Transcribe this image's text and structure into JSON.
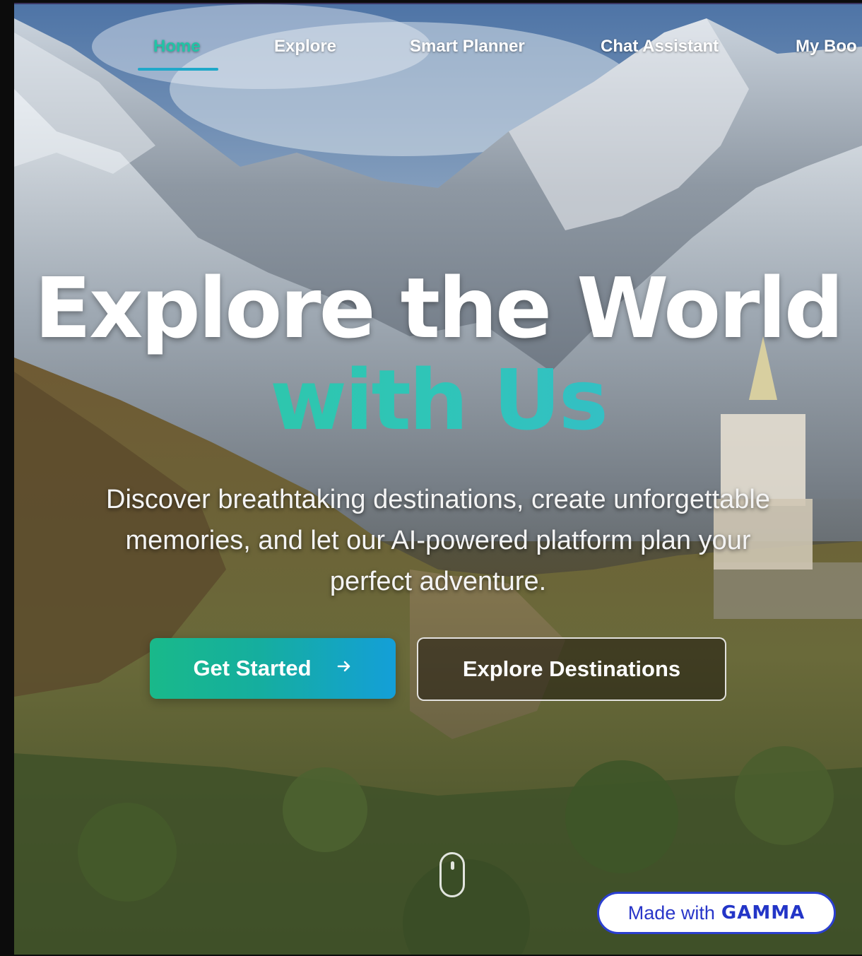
{
  "nav": {
    "items": [
      {
        "label": "Home",
        "active": true
      },
      {
        "label": "Explore",
        "active": false
      },
      {
        "label": "Smart Planner",
        "active": false
      },
      {
        "label": "Chat Assistant",
        "active": false
      },
      {
        "label": "My Boo",
        "active": false
      }
    ]
  },
  "hero": {
    "headline": "Explore the World",
    "headline_accent": "with Us",
    "subtitle_lines": [
      "Discover breathtaking destinations, create unforgettable",
      "memories, and let our AI-powered platform plan your",
      "perfect adventure."
    ],
    "primary_button": {
      "label": "Get Started",
      "icon": "arrow-right-icon"
    },
    "secondary_button": {
      "label": "Explore Destinations"
    },
    "scroll_indicator_icon": "mouse-scroll-icon"
  },
  "badge": {
    "prefix": "Made with",
    "brand": "GAMMA"
  },
  "colors": {
    "accent_teal": "#22c3a6",
    "accent_blue": "#149fd8",
    "badge_blue": "#2335c7"
  }
}
